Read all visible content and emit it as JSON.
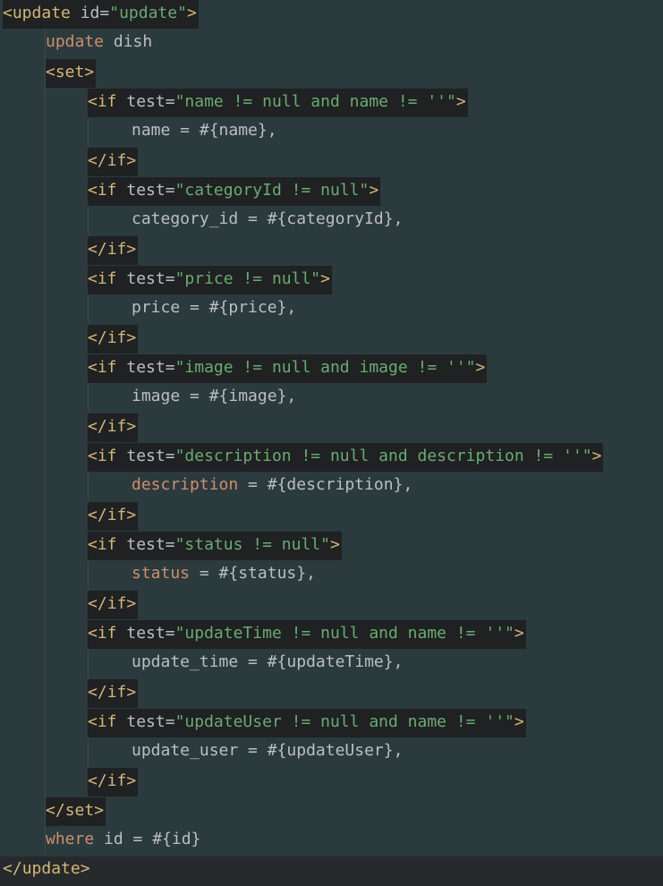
{
  "code": {
    "update_open": {
      "tag": "update",
      "attr": "id",
      "value": "\"update\""
    },
    "update_stmt": {
      "keyword": "update",
      "rest": " dish"
    },
    "set_open": "set",
    "blocks": [
      {
        "test": "\"name != null and name != ''\"",
        "body": [
          {
            "t": "plain",
            "v": "name = #{name},"
          }
        ]
      },
      {
        "test": "\"categoryId != null\"",
        "body": [
          {
            "t": "plain",
            "v": "category_id = #{categoryId},"
          }
        ]
      },
      {
        "test": "\"price != null\"",
        "body": [
          {
            "t": "plain",
            "v": "price = #{price},"
          }
        ]
      },
      {
        "test": "\"image != null and image != ''\"",
        "body": [
          {
            "t": "plain",
            "v": "image = #{image},"
          }
        ]
      },
      {
        "test": "\"description != null and description != ''\"",
        "body": [
          {
            "t": "kw",
            "v": "description"
          },
          {
            "t": "plain",
            "v": " = #{description},"
          }
        ]
      },
      {
        "test": "\"status != null\"",
        "body": [
          {
            "t": "kw",
            "v": "status"
          },
          {
            "t": "plain",
            "v": " = #{status},"
          }
        ]
      },
      {
        "test": "\"updateTime != null and name != ''\"",
        "body": [
          {
            "t": "plain",
            "v": "update_time = #{updateTime},"
          }
        ]
      },
      {
        "test": "\"updateUser != null and name != ''\"",
        "body": [
          {
            "t": "plain",
            "v": "update_user = #{updateUser},"
          }
        ]
      }
    ],
    "if_tag": "if",
    "test_attr": "test",
    "set_close": "set",
    "where_stmt": {
      "keyword": "where",
      "rest": " id = #{id}"
    },
    "update_close": "update"
  },
  "colors": {
    "background": "#2b3a3d",
    "tag": "#d5b778",
    "string": "#6aab73",
    "keyword": "#cf8e6d",
    "text": "#bcbec4"
  }
}
